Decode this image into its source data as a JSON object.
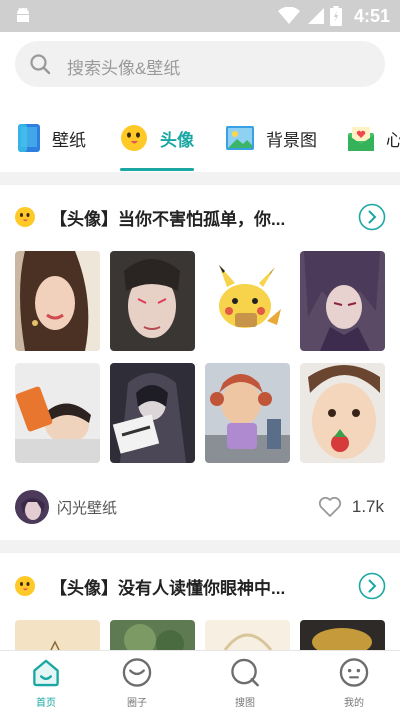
{
  "status_bar": {
    "time": "4:51"
  },
  "search": {
    "placeholder": "搜索头像&壁纸"
  },
  "tabs": [
    {
      "label": "壁纸",
      "icon": "phone-wallpaper-icon",
      "active": false
    },
    {
      "label": "头像",
      "icon": "smiley-face-icon",
      "active": true
    },
    {
      "label": "背景图",
      "icon": "landscape-picture-icon",
      "active": false
    },
    {
      "label": "心",
      "icon": "heart-envelope-icon",
      "active": false
    }
  ],
  "cards": [
    {
      "title": "【头像】当你不害怕孤单，你...",
      "author": "闪光壁纸",
      "likes": "1.7k"
    },
    {
      "title": "【头像】没有人读懂你眼神中..."
    }
  ],
  "bottom_nav": [
    {
      "label": "首页",
      "icon": "home-icon",
      "active": true
    },
    {
      "label": "圈子",
      "icon": "circle-smile-icon",
      "active": false
    },
    {
      "label": "搜图",
      "icon": "search-icon",
      "active": false
    },
    {
      "label": "我的",
      "icon": "profile-face-icon",
      "active": false
    }
  ],
  "colors": {
    "accent": "#1aa7a3",
    "status_bar": "#cfcfcf"
  }
}
